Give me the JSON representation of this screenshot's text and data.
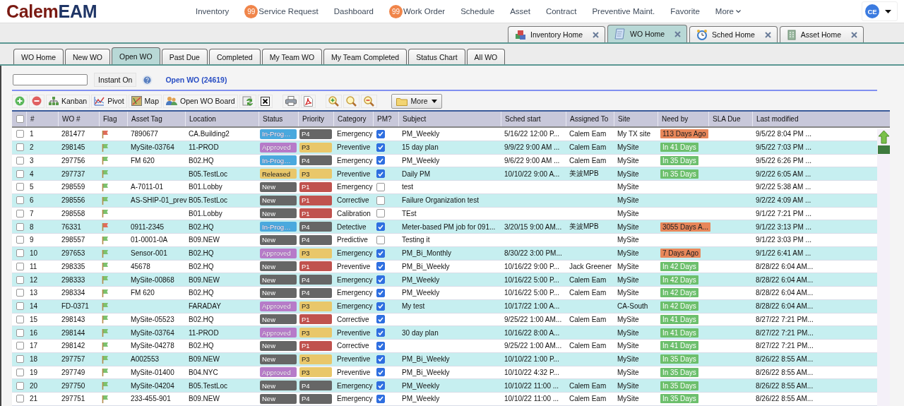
{
  "logo": {
    "text_1": "Calem",
    "text_2": "EAM"
  },
  "nav": [
    {
      "label": "Inventory"
    },
    {
      "label": "Service Request",
      "badge": "99"
    },
    {
      "label": "Dashboard"
    },
    {
      "label": "Work Order",
      "badge": "99"
    },
    {
      "label": "Schedule"
    },
    {
      "label": "Asset"
    },
    {
      "label": "Contract"
    },
    {
      "label": "Preventive Maint."
    },
    {
      "label": "Favorite"
    },
    {
      "label": "More",
      "kind": "menu"
    }
  ],
  "user": {
    "initials": "CE"
  },
  "doc_tabs": [
    {
      "label": "Inventory Home",
      "kind": "inventory",
      "selected": false
    },
    {
      "label": "WO Home",
      "kind": "wo",
      "selected": true
    },
    {
      "label": "Sched Home",
      "kind": "sched",
      "selected": false
    },
    {
      "label": "Asset Home",
      "kind": "asset",
      "selected": false
    }
  ],
  "wo_tabs": [
    {
      "label": "WO Home",
      "selected": false
    },
    {
      "label": "New WO",
      "selected": false
    },
    {
      "label": "Open WO",
      "selected": true
    },
    {
      "label": "Past Due",
      "selected": false
    },
    {
      "label": "Completed",
      "selected": false
    },
    {
      "label": "My Team WO",
      "selected": false
    },
    {
      "label": "My Team Completed",
      "selected": false
    },
    {
      "label": "Status Chart",
      "selected": false
    },
    {
      "label": "All WO",
      "selected": false
    }
  ],
  "search": {
    "instant_button": "Instant On",
    "list_title": "Open WO (24619)"
  },
  "toolbar": [
    {
      "kind": "add"
    },
    {
      "kind": "remove"
    },
    {
      "kind": "kanban",
      "label": "Kanban"
    },
    {
      "kind": "pivot",
      "label": "Pivot"
    },
    {
      "kind": "map",
      "label": "Map"
    },
    {
      "kind": "board",
      "label": "Open WO Board"
    },
    {
      "kind": "refresh"
    },
    {
      "kind": "clear"
    },
    {
      "kind": "print"
    },
    {
      "kind": "pdf"
    },
    {
      "kind": "zoom_in"
    },
    {
      "kind": "zoom"
    },
    {
      "kind": "zoom_out"
    },
    {
      "kind": "more",
      "label": "More"
    }
  ],
  "table": {
    "select_all_checked": false,
    "columns": [
      "#",
      "WO #",
      "Flag",
      "Asset Tag",
      "Location",
      "Status",
      "Priority",
      "Category",
      "PM?",
      "Subject",
      "Sched start",
      "Assigned To",
      "Site",
      "Need by",
      "SLA Due",
      "Last modified"
    ],
    "rows": [
      {
        "checked": false,
        "num": "1",
        "wo": "281477",
        "flag": {
          "color": "#e06c5a"
        },
        "asset": "7890677",
        "location": "CA.Building2",
        "status": {
          "text": "In-Prog…",
          "color": "#4aa9de"
        },
        "priority": {
          "text": "P4",
          "color": "#666666"
        },
        "category": "Emergency",
        "pm": true,
        "subject": "PM_Weekly",
        "sched": "5/16/22 12:00 P...",
        "assigned": "Calem Eam",
        "site": "My TX site",
        "need_by": {
          "text": "113 Days Ago",
          "color": "#e8875a"
        },
        "modified": "9/5/22 8:04 PM ..."
      },
      {
        "checked": false,
        "num": "2",
        "wo": "298145",
        "flag": {
          "color": "#7cc26e"
        },
        "asset": "MySite-03764",
        "location": "11-PROD",
        "status": {
          "text": "Approved",
          "color": "#b77bc9"
        },
        "priority": {
          "text": "P3",
          "color": "#e9c76a"
        },
        "category": "Preventive",
        "pm": true,
        "subject": "15 day plan",
        "sched": "9/9/22 9:00 AM ...",
        "assigned": "Calem Eam",
        "site": "MySite",
        "need_by": {
          "text": "In 41 Days",
          "color": "#6cbf6c"
        },
        "modified": "9/5/22 7:03 PM ..."
      },
      {
        "checked": false,
        "num": "3",
        "wo": "297756",
        "flag": {
          "color": "#7cc26e"
        },
        "asset": "FM 620",
        "location": "B02.HQ",
        "status": {
          "text": "In-Prog…",
          "color": "#4aa9de"
        },
        "priority": {
          "text": "P4",
          "color": "#666666"
        },
        "category": "Emergency",
        "pm": true,
        "subject": "PM_Weekly",
        "sched": "9/6/22 9:00 AM ...",
        "assigned": "Calem Eam",
        "site": "MySite",
        "need_by": {
          "text": "In 35 Days",
          "color": "#6cbf6c"
        },
        "modified": "9/5/22 6:26 PM ..."
      },
      {
        "checked": false,
        "num": "4",
        "wo": "297737",
        "flag": {
          "color": "#7cc26e"
        },
        "location": "B05.TestLoc",
        "status": {
          "text": "Released",
          "color": "#e9c76a"
        },
        "priority": {
          "text": "P3",
          "color": "#e9c76a"
        },
        "category": "Preventive",
        "pm": true,
        "subject": "Daily PM",
        "sched": "10/10/22 9:00 A...",
        "assigned": "美波MPB",
        "site": "MySite",
        "need_by": {
          "text": "In 35 Days",
          "color": "#6cbf6c"
        },
        "modified": "9/2/22 6:05 AM ..."
      },
      {
        "checked": false,
        "num": "5",
        "wo": "298559",
        "flag": {
          "color": "#7cc26e"
        },
        "asset": "A-7011-01",
        "location": "B01.Lobby",
        "status": {
          "text": "New",
          "color": "#666666"
        },
        "priority": {
          "text": "P1",
          "color": "#c0524e"
        },
        "category": "Emergency",
        "pm": false,
        "subject": "test",
        "site": "MySite",
        "modified": "9/2/22 5:38 AM ..."
      },
      {
        "checked": false,
        "num": "6",
        "wo": "298556",
        "flag": {
          "color": "#7cc26e"
        },
        "asset": "AS-SHIP-01_prev",
        "location": "B05.TestLoc",
        "status": {
          "text": "New",
          "color": "#666666"
        },
        "priority": {
          "text": "P1",
          "color": "#c0524e"
        },
        "category": "Corrective",
        "pm": false,
        "subject": "Failure Organization test",
        "site": "MySite",
        "modified": "9/2/22 4:09 AM ..."
      },
      {
        "checked": false,
        "num": "7",
        "wo": "298558",
        "flag": {
          "color": "#7cc26e"
        },
        "location": "B01.Lobby",
        "status": {
          "text": "New",
          "color": "#666666"
        },
        "priority": {
          "text": "P1",
          "color": "#c0524e"
        },
        "category": "Calibration",
        "pm": false,
        "subject": "TEst",
        "site": "MySite",
        "modified": "9/1/22 7:21 PM ..."
      },
      {
        "checked": false,
        "num": "8",
        "wo": "76331",
        "flag": {
          "color": "#e06c5a"
        },
        "asset": "0911-2345",
        "location": "B02.HQ",
        "status": {
          "text": "In-Prog…",
          "color": "#4aa9de"
        },
        "priority": {
          "text": "P4",
          "color": "#666666"
        },
        "category": "Detective",
        "pm": true,
        "subject": "Meter-based PM job for 091...",
        "sched": "3/20/15 9:00 AM...",
        "assigned": "美波MPB",
        "site": "MySite",
        "need_by": {
          "text": "3055 Days A...",
          "color": "#e8875a"
        },
        "modified": "9/1/22 3:13 PM ..."
      },
      {
        "checked": false,
        "num": "9",
        "wo": "298557",
        "flag": {
          "color": "#7cc26e"
        },
        "asset": "01-0001-0A",
        "location": "B09.NEW",
        "status": {
          "text": "New",
          "color": "#666666"
        },
        "priority": {
          "text": "P4",
          "color": "#666666"
        },
        "category": "Predictive",
        "pm": false,
        "subject": "Testing it",
        "site": "MySite",
        "modified": "9/1/22 3:03 PM ..."
      },
      {
        "checked": false,
        "num": "10",
        "wo": "297653",
        "flag": {
          "color": "#7cc26e"
        },
        "asset": "Sensor-001",
        "location": "B02.HQ",
        "status": {
          "text": "Approved",
          "color": "#b77bc9"
        },
        "priority": {
          "text": "P3",
          "color": "#e9c76a"
        },
        "category": "Emergency",
        "pm": true,
        "subject": "PM_Bi_Monthly",
        "sched": "8/30/22 3:00 PM...",
        "site": "MySite",
        "need_by": {
          "text": "7 Days Ago",
          "color": "#e8875a"
        },
        "modified": "9/1/22 6:41 AM ..."
      },
      {
        "checked": false,
        "num": "11",
        "wo": "298335",
        "flag": {
          "color": "#7cc26e"
        },
        "asset": "45678",
        "location": "B02.HQ",
        "status": {
          "text": "New",
          "color": "#666666"
        },
        "priority": {
          "text": "P1",
          "color": "#c0524e"
        },
        "category": "Preventive",
        "pm": true,
        "subject": "PM_Bi_Weekly",
        "sched": "10/16/22 9:00 P...",
        "assigned": "Jack Greener",
        "site": "MySite",
        "need_by": {
          "text": "In 42 Days",
          "color": "#6cbf6c"
        },
        "modified": "8/28/22 6:04 AM..."
      },
      {
        "checked": false,
        "num": "12",
        "wo": "298333",
        "flag": {
          "color": "#7cc26e"
        },
        "asset": "MySite-00868",
        "location": "B09.NEW",
        "status": {
          "text": "New",
          "color": "#666666"
        },
        "priority": {
          "text": "P4",
          "color": "#666666"
        },
        "category": "Emergency",
        "pm": true,
        "subject": "PM_Weekly",
        "sched": "10/16/22 5:00 P...",
        "assigned": "Calem Eam",
        "site": "MySite",
        "need_by": {
          "text": "In 42 Days",
          "color": "#6cbf6c"
        },
        "modified": "8/28/22 6:04 AM..."
      },
      {
        "checked": false,
        "num": "13",
        "wo": "298334",
        "flag": {
          "color": "#7cc26e"
        },
        "asset": "FM 620",
        "location": "B02.HQ",
        "status": {
          "text": "New",
          "color": "#666666"
        },
        "priority": {
          "text": "P4",
          "color": "#666666"
        },
        "category": "Emergency",
        "pm": true,
        "subject": "PM_Weekly",
        "sched": "10/16/22 5:00 P...",
        "assigned": "Calem Eam",
        "site": "MySite",
        "need_by": {
          "text": "In 42 Days",
          "color": "#6cbf6c"
        },
        "modified": "8/28/22 6:04 AM..."
      },
      {
        "checked": false,
        "num": "14",
        "wo": "FD-0371",
        "flag": {
          "color": "#7cc26e"
        },
        "location": "FARADAY",
        "status": {
          "text": "Approved",
          "color": "#b77bc9"
        },
        "priority": {
          "text": "P3",
          "color": "#e9c76a"
        },
        "category": "Emergency",
        "pm": true,
        "subject": "My test",
        "sched": "10/17/22 1:00 A...",
        "site": "CA-South",
        "need_by": {
          "text": "In 42 Days",
          "color": "#6cbf6c"
        },
        "modified": "8/28/22 6:04 AM..."
      },
      {
        "checked": false,
        "num": "15",
        "wo": "298143",
        "flag": {
          "color": "#7cc26e"
        },
        "asset": "MySite-05523",
        "location": "B02.HQ",
        "status": {
          "text": "New",
          "color": "#666666"
        },
        "priority": {
          "text": "P1",
          "color": "#c0524e"
        },
        "category": "Corrective",
        "pm": true,
        "sched": "9/25/22 1:00 AM...",
        "assigned": "Calem Eam",
        "site": "MySite",
        "need_by": {
          "text": "In 41 Days",
          "color": "#6cbf6c"
        },
        "modified": "8/27/22 7:21 PM..."
      },
      {
        "checked": false,
        "num": "16",
        "wo": "298144",
        "flag": {
          "color": "#7cc26e"
        },
        "asset": "MySite-03764",
        "location": "11-PROD",
        "status": {
          "text": "Approved",
          "color": "#b77bc9"
        },
        "priority": {
          "text": "P3",
          "color": "#e9c76a"
        },
        "category": "Preventive",
        "pm": true,
        "subject": "30 day plan",
        "sched": "10/16/22 8:00 A...",
        "site": "MySite",
        "need_by": {
          "text": "In 41 Days",
          "color": "#6cbf6c"
        },
        "modified": "8/27/22 7:21 PM..."
      },
      {
        "checked": false,
        "num": "17",
        "wo": "298142",
        "flag": {
          "color": "#7cc26e"
        },
        "asset": "MySite-04278",
        "location": "B02.HQ",
        "status": {
          "text": "New",
          "color": "#666666"
        },
        "priority": {
          "text": "P1",
          "color": "#c0524e"
        },
        "category": "Corrective",
        "pm": true,
        "sched": "9/25/22 1:00 AM...",
        "assigned": "Calem Eam",
        "site": "MySite",
        "need_by": {
          "text": "In 41 Days",
          "color": "#6cbf6c"
        },
        "modified": "8/27/22 7:21 PM..."
      },
      {
        "checked": false,
        "num": "18",
        "wo": "297757",
        "flag": {
          "color": "#7cc26e"
        },
        "asset": "A002553",
        "location": "B09.NEW",
        "status": {
          "text": "New",
          "color": "#666666"
        },
        "priority": {
          "text": "P3",
          "color": "#e9c76a"
        },
        "category": "Preventive",
        "pm": true,
        "subject": "PM_Bi_Weekly",
        "sched": "10/10/22 1:00 P...",
        "site": "MySite",
        "need_by": {
          "text": "In 35 Days",
          "color": "#6cbf6c"
        },
        "modified": "8/26/22 8:55 AM..."
      },
      {
        "checked": false,
        "num": "19",
        "wo": "297749",
        "flag": {
          "color": "#7cc26e"
        },
        "asset": "MySite-01400",
        "location": "B04.NYC",
        "status": {
          "text": "Approved",
          "color": "#b77bc9"
        },
        "priority": {
          "text": "P3",
          "color": "#e9c76a"
        },
        "category": "Preventive",
        "pm": true,
        "subject": "PM_Bi_Weekly",
        "sched": "10/10/22 4:32 P...",
        "site": "MySite",
        "need_by": {
          "text": "In 35 Days",
          "color": "#6cbf6c"
        },
        "modified": "8/26/22 8:55 AM..."
      },
      {
        "checked": false,
        "num": "20",
        "wo": "297750",
        "flag": {
          "color": "#7cc26e"
        },
        "asset": "MySite-04204",
        "location": "B05.TestLoc",
        "status": {
          "text": "New",
          "color": "#666666"
        },
        "priority": {
          "text": "P4",
          "color": "#666666"
        },
        "category": "Emergency",
        "pm": true,
        "subject": "PM_Weekly",
        "sched": "10/10/22 11:00 ...",
        "assigned": "Calem Eam",
        "site": "MySite",
        "need_by": {
          "text": "In 35 Days",
          "color": "#6cbf6c"
        },
        "modified": "8/26/22 8:55 AM..."
      },
      {
        "checked": false,
        "num": "21",
        "wo": "297751",
        "flag": {
          "color": "#7cc26e"
        },
        "asset": "233-455-901",
        "location": "B09.NEW",
        "status": {
          "text": "New",
          "color": "#666666"
        },
        "priority": {
          "text": "P4",
          "color": "#666666"
        },
        "category": "Emergency",
        "pm": true,
        "subject": "PM_Weekly",
        "sched": "10/10/22 11:00 ...",
        "assigned": "Calem Eam",
        "site": "MySite",
        "need_by": {
          "text": "In 35 Days",
          "color": "#6cbf6c"
        },
        "modified": "8/26/22 8:55 AM..."
      }
    ]
  }
}
